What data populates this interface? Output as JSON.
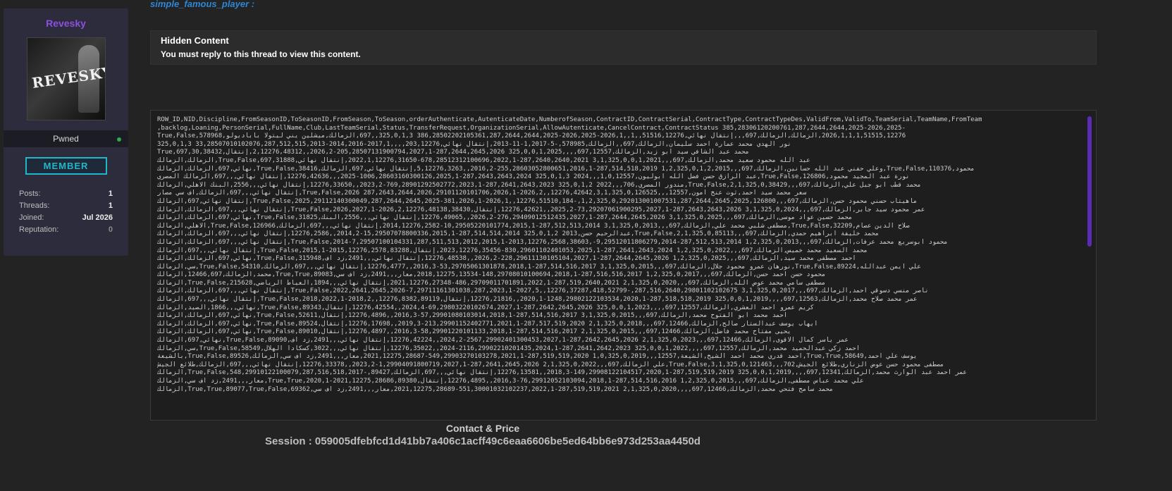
{
  "profile": {
    "username": "Revesky",
    "avatar_text": "REVESKY",
    "rank": "Pwned",
    "badge": "MEMBER",
    "stats": [
      {
        "label": "Posts:",
        "value": "1"
      },
      {
        "label": "Threads:",
        "value": "1"
      },
      {
        "label": "Joined:",
        "value": "Jul 2026"
      },
      {
        "label": "Reputation:",
        "value": "0"
      }
    ],
    "colors": {
      "username": "#8d4fe0",
      "badge": "#21b7c9",
      "online": "#2fa84f"
    }
  },
  "post": {
    "mentioned_user": "simple_famous_player :",
    "hidden_title": "Hidden Content",
    "hidden_message": "You must reply to this thread to view this content."
  },
  "code_lines": [
    "ROW_ID,NID,Discipline,FromSeasonID,ToSeasonID,FromSeason,ToSeason,orderAuthenticate,AutenticateDate,NumberofSeason,ContractID,ContractSerial,ContractType,ContractTypeDes,ValidFrom,ValidTo,TeamSerial,TeamName,FromTeam",
    ",backlog,Loaning,PersonSerial,FullName,Club,LastTeamSerial,Status,TransferRequest,OrganizationSerial,AllowAutenticate,CancelContract,ContractStatus 385,28306120200761,287,2644,2644,2025-2026,2025-",
    "2026,1,1,1,51515,12276,الزمالك,الزمالك,697,,,إنتقال نهائي,51516,12276,,1,,2026,1-2026,2025-386,28502202105361,287,2644,2644,2025 325,0,1,3,,697,الزمالك,ميشلين يني ليتولا باباديولو,True,False,578968",
    "نور الهدي محمد عمارة احمد سليمان,الزمالك,697,,الزمالك,578985,-5-1,2017-11-2013,إنتقال نهائي,203,12276,,,,2017,1-2014,2016-33,28507010102076,287,512,515,2013 325,0,1,3",
    "محمد عبد الشافي سيد أبو زيد,الزمالك,697,12557,,,,325,0,0,1,2025 287,2644,2645,2026-205,28507131900794,2027,1-2026,2,,2,12276,48312,إنتقال,38432,True,697,30",
    "عبد الله محمود سعيد محمد,الزمالك,697,,,3,1,325,0,0,1,2021 287,2640,2640,2021-678,28512312100696,2022,1-2022,1,12276,31650,إنتقال نهائي,31888,True,False,697,الزمالك,الزمالك",
    "محمود,110376,True,False,وعلي حفني عبد الله حسانين,الزمالك,697,,,1,2,325,0,1,2,2015 287,514,518,2019-255,28603052800651,2016,1-2016,2,,5,12276,3263,إنتقال نهائي,697,الزمالك,38416,True,False,نهائي,697,الزمالك,الزمالك",
    "نورة عبد المجيد محمود,126806,True,False,عبد الرازق حسن فضل الله ابوليون,1,0,12557,,,2024 325,0,1,3 287,2643,2643,2024-1006,28603160300126,2025,1-2025,,,12276,42636,إنتقال نهائي,,,697,الزمالك المصري",
    "محمد قطب أبو جبل علي,الزمالك,697,,,2,1,325,0,38429,True,False,مندور المصري,706,,,2022 325,0,1,2 287,2641,2643,2023-769,28901292502772,2023,1-2023,2,,12276,33650,إنتقال نهائي,,,2556,البنك الاهلي,الزمالك",
    "سعر محمد سيد احمد,ثوت عنخ أمون,12557,,,3,1,325,0,126525,True,False,2026 287,2643,2644,2026,29101120101706,2026,1-2026,2,,12276,42642,إنتقال نهائي,,,697,الزمالك,اف سي مصار",
    "ماهيتاب حسني محمود حسن,الزمالك,697,,,1,2,325,0,292013001007531,287,2644,2645,2025,126800,-184,True,False,2025,29112140300049,287,2644,2645,2025-381,2026,1-2026,1,,12276,51510,إنتقال نهائي,697,الزمالك",
    "عمر محمود سيد جابر,الزمالك,697,,,3,1,325,0,2024 287,2643,2643,2026-73,29207061900295,2027,1-2025,2,,12276,42621,إنتقال,38430,True,False,2026,2027,1-2026,2,12276,48138,إنتقال نهائي,,,697,الزمالك,الزمالك",
    "محمد حسين عواد موسى,الزمالك,697,,,3,1,325,0,2025 287,2644,2645,2026-276,29409012512435,2027,1-2026,2,,12276,49065,إنتقال نهائي,,,2556,البنك,31825,True,False,نهائي,697,الزمالك,الزمالك",
    "صلاح الدين عصام,32209,True,False,مصطفى شلبي محمد علي,الزمالك,697,,,3,1,325,0,2013 287,512,513,2014-10,29505220101774,2015,1-2014,12276,2582,إنتقال نهائي,,,697,الزمالك,126966,True,False,الاهلي,الزمالك",
    "محمد خليفة ابراهيم حمدي,الزمالك,697,,,2,1,325,0,85113,True,False,عبدالرحيم حسن,2013 325,0,1,2 287,514,514,2014-15,29507078800336,2015,1-2014,2,,12276,2586,إنتقال نهائي,,,697,الزمالك,الزمالك",
    "محمود ابوسريع محمد عرفات,الزمالك,697,,,1,2,325,0,2013 287,512,513,2014-9,29512011806279,2014-,38603,True,False,2014-7,29507100104331,287,511,513,2012,2015,1-2013,12276,2568,إنتقال نهائي,,,697,الزمالك,الزمالك",
    "محمد السعيد محمد خميس,الزمالك,697,,,1,2,325,0,2022 287,2641,2643,2024-830,29601102401053,2025,1-2023,12276,35456,إنتقال,83288,True,False,2015,1-2015,12276,2578,إنتقال نهائي,,,697,الزمالك",
    "احمد مصطفى محمد سيد,الزمالك,697,,,1,2,325,0,2025 287,2644,2645,2026-228,29611130105104,2027,1-2026,2,,12276,48538,إنتقال نهائي,,,2491,زد اف,315948,True,False,نهائي,697,الزمالك,الزمالك",
    "علي ايمن عبدالله,89224,True,False,نورهان عمرو محمود جلال,الزمالك,697,,,3,1,325,0,2015 287,514,516,2017-53,29705061301878,2018,1-2016,3,,12276,4777,إنتقال نهائي,,,697,الزمالك,54310,True,False,سي,الزمالك",
    "محمود حسن احمد حسن,الزمالك,697,,,1,2,325,0,2017 287,516,516,2017-148,29708010100694,2018,1-2018,12275,13534,معار,,,2491,زد اف سي,89083,True,True,محمد,الزمالك,12466,697,الزمالك",
    "مصطفى سامي محمد عوض الله,الزمالك,697,,,2,1,325,0,2020 287,519,2640,2021-486,29709011701891,2022,1-2021,12276,27348,إنتقال نهائي,,,1894,العياط الرياضي,215628,True,False,الزمالك",
    "ناصر منسي دسوقي احمد,الزمالك,697,,,3,1,325,0,2017 287,516,2640,29801102102675,-418,52799,True,False,2022,2641,2645,2026-7,29711161301038,287,2023,1-2027,5,,12276,37287,إنتقال نهائي,,,697,الزمالك,الزمالك",
    "عمر محمد صلاح محمد,الزمالك,697,12563,,,,325,0,0,1,2019 287,518,518,2019-1248,29802122103534,2020,1-2020,1,,12276,21816,إنتقال,89119,True,False,2018,2022,1-2018,2,,12276,8382,إنتقال نهائي,,,697,الزمالك",
    "كريم عمرو احمد العشري,الزمالك,697,12557,,,,325,0,0,1,2023 287,2642,2645,2026-69,29803220102674,2027,1-2024,4,,12276,42554,إنتقال,89343,True,False,نهائي,,,1866,الصيد,الزمالك",
    "احمد محمد ابو الفتوح محمد,الزمالك,697,,,3,1,325,0,2015 287,514,516,2017-57,29901080103014,2018,1-2016,3,,12276,4896,إنتقال,52611,True,False,نهائي,697,الزمالك,الزمالك",
    "ايهاب يوسف عبدالستار صالح,الزمالك,697,12466,,,2,1,325,0,2018 287,517,519,2020-213,29901152402771,2021,1-2019,3,,12276,17698,إنتقال,89524,True,False,نهائي,697,الزمالك,الزمالك",
    "يحيى مفتاح محمد فاضل,الزمالك,697,12466,,,2,1,325,0,2015 287,514,516,2017-58,29901220101133,2018,1-2016,3,,12276,4897,إنتقال,89010,True,False,نهائي,697,الزمالك,الزمالك",
    "عمر ياسر كمال الاقوى,الزمالك,697,12466,,,2,1,325,0,2023 287,2642,2645,2026-2567,29902401300453,2027,1-2024,2,,12276,42224,إنتقال نهائي,,,2491,زد اف,89090,True,False,نهائي,697,الزمالك",
    "احمد زكي عبدالحميد محمد,الزمالك,697,12557,,,,325,0,0,1,2022 287,2641,2642,2023-2116,29902210201435,2024,1-2024,,12276,35022,إنتقال نهائي,,,3022,كسكادا الهلال,58549,True,False,سي,الزمالك",
    "يوسف علي احمد,58649,True,True,احمد قدري محمد احمد الشيخ,الشيعة,12557,,,1,0,325,0,2019 287,519,519,2020-549,29903270103278,2021,1-2021,12275,28687,معار,,,2491,زد اف سي,الزمالك,89526,True,False,بالشيعة",
    "مصطفى محمود حسن عوض الزناري,طلائع الجيش,702,,,3,1,325,0,121463,True,False,علي الزمالك,697,,,2,1,325,0,2022 287,2641,2645,2026-1,29904091800719,2027,1-2023,2,,12276,33378,إنتقال نهائي,,,697,الزمالك,طلائع الجيش",
    "عمر احمد عبد الوارث محمد,الزمالك,697,12341,,,,325,0,0,1,2019 287,519,519,2019-149,29908122104517,2020,1-2018,3,,12276,13581,إنتقال نهائي,,,697,الزمالك,89427,-548,29910122100079,287,516,518,2017,True,False,الزمالك",
    "علي محمد عباس مصطفى,الزمالك,697,,,1,2,325,0,2015 287,514,516,2016-76,29912052103094,2018,1-2016,3,,12276,4895,إنتقال,89380,True,True,2020,1-2021,12275,28686,معار,,,2491,زد اف سي,الزمالك",
    "محمد سامح فتحي محمد,الزمالك,697,12466,,,,2,1,325,0,2020 287,519,519,2021-551,30001032102237,2022,1-2021,12275,28689,معار,,,2491,زد اف سي,69362,True,True,89077,True,False,الزمالك"
  ],
  "footer": {
    "contact": "Contact & Price",
    "session": "Session : 059005dfebfcd1d41bb7a406c1acff49c6eaa6606be5ed64bb6e973d253aa4450d"
  }
}
